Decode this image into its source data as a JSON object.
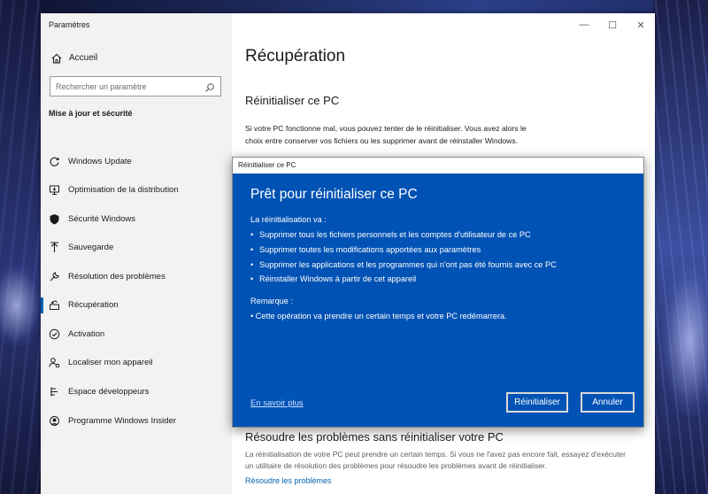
{
  "window": {
    "title": "Paramètres",
    "controls": {
      "minimize": "—",
      "maximize": "☐",
      "close": "✕"
    }
  },
  "sidebar": {
    "home_label": "Accueil",
    "search_placeholder": "Rechercher un paramètre",
    "section_label": "Mise à jour et sécurité",
    "items": [
      {
        "label": "Windows Update",
        "icon": "refresh-icon"
      },
      {
        "label": "Optimisation de la distribution",
        "icon": "delivery-optimization-icon"
      },
      {
        "label": "Sécurité Windows",
        "icon": "shield-icon"
      },
      {
        "label": "Sauvegarde",
        "icon": "backup-arrow-icon"
      },
      {
        "label": "Résolution des problèmes",
        "icon": "wrench-icon"
      },
      {
        "label": "Récupération",
        "icon": "recovery-icon",
        "active": true
      },
      {
        "label": "Activation",
        "icon": "check-circle-icon"
      },
      {
        "label": "Localiser mon appareil",
        "icon": "person-location-icon"
      },
      {
        "label": "Espace développeurs",
        "icon": "developer-icon"
      },
      {
        "label": "Programme Windows Insider",
        "icon": "insider-icon"
      }
    ]
  },
  "main": {
    "title": "Récupération",
    "reset_section": {
      "title": "Réinitialiser ce PC",
      "body": "Si votre PC fonctionne mal, vous pouvez tenter de le réinitialiser. Vous avez alors le choix entre conserver vos fichiers ou les supprimer avant de réinstaller Windows."
    },
    "troubleshoot_section": {
      "title": "Résoudre les problèmes sans réinitialiser votre PC",
      "body": "La réinitialisation de votre PC peut prendre un certain temps. Si vous ne l'avez pas encore fait, essayez d'exécuter un utilitaire de résolution des problèmes pour résoudre les problèmes avant de réinitialiser.",
      "link": "Résoudre les problèmes"
    }
  },
  "dialog": {
    "window_title": "Réinitialiser ce PC",
    "heading": "Prêt pour réinitialiser ce PC",
    "intro": "La réinitialisation va :",
    "bullets": [
      "Supprimer tous les fichiers personnels et les comptes d'utilisateur de ce PC",
      "Supprimer toutes les modifications apportées aux paramètres",
      "Supprimer les applications et les programmes qui n'ont pas été fournis avec ce PC",
      "Réinstaller Windows à partir de cet appareil"
    ],
    "note_label": "Remarque :",
    "note": "• Cette opération va prendre un certain temps et votre PC redémarrera.",
    "learn_more": "En savoir plus",
    "reset_button": "Réinitialiser",
    "cancel_button": "Annuler"
  },
  "colors": {
    "accent": "#0063b1",
    "dialog_background": "#0052b4",
    "sidebar_background": "#f2f2f2"
  }
}
